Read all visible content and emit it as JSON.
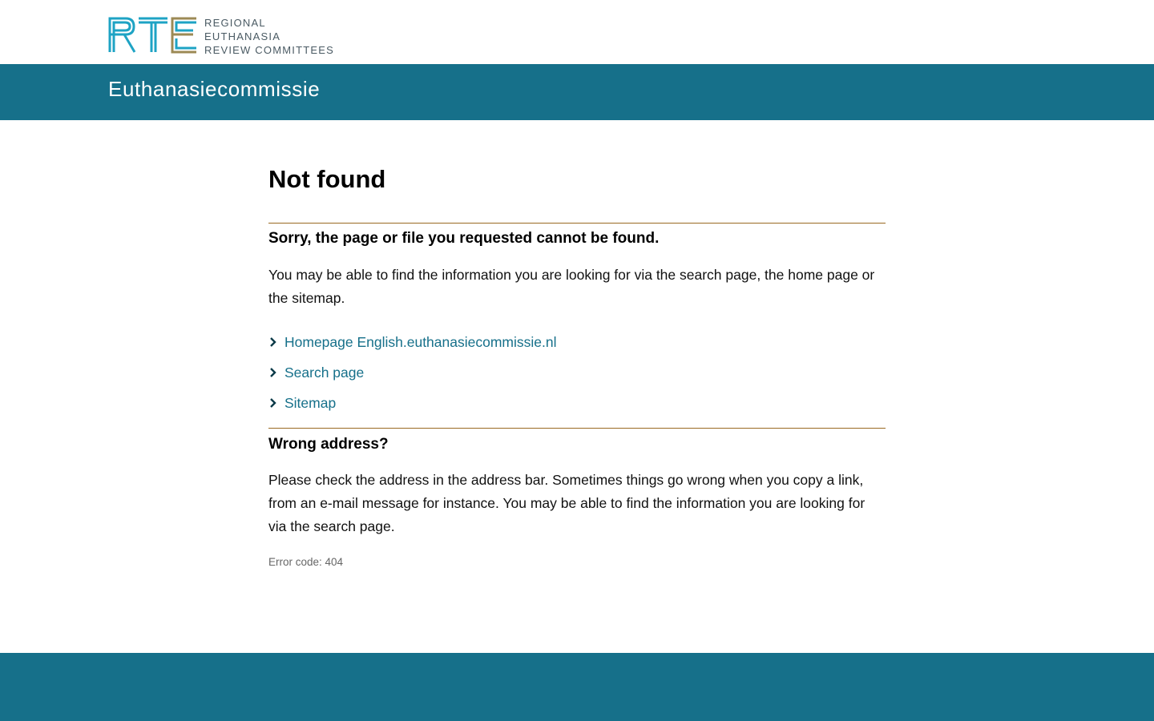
{
  "logo": {
    "mark": "RTE",
    "line1": "REGIONAL",
    "line2": "EUTHANASIA",
    "line3": "REVIEW COMMITTEES"
  },
  "site_bar": {
    "title": "Euthanasiecommissie"
  },
  "main": {
    "title": "Not found",
    "section1": {
      "heading": "Sorry, the page or file you requested cannot be found.",
      "text": "You may be able to find the information you are looking for via the search page, the home page or the sitemap.",
      "links": [
        {
          "label": "Homepage English.euthanasiecommissie.nl",
          "icon": "chevron-right-icon"
        },
        {
          "label": "Search page",
          "icon": "chevron-right-icon"
        },
        {
          "label": "Sitemap",
          "icon": "chevron-right-icon"
        }
      ]
    },
    "section2": {
      "heading": "Wrong address?",
      "text": "Please check the address in the address bar. Sometimes things go wrong when you copy a link, from an e-mail message for instance. You may be able to find the information you are looking for via the search page."
    },
    "error_code": "Error code: 404"
  },
  "colors": {
    "brand_blue": "#16708a",
    "logo_teal": "#1ea3c4",
    "logo_gold": "#9c8a55",
    "rule": "#9a6a22"
  }
}
